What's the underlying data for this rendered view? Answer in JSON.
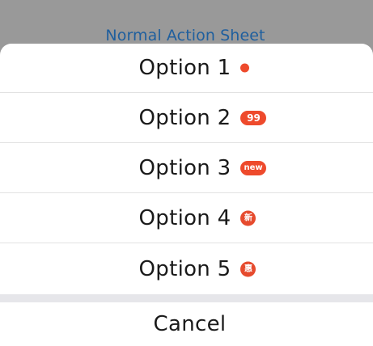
{
  "background_page": {
    "title": "Normal Action Sheet"
  },
  "action_sheet": {
    "options": [
      {
        "label": "Option 1",
        "badge_type": "dot",
        "badge_text": ""
      },
      {
        "label": "Option 2",
        "badge_type": "pill",
        "badge_text": "99"
      },
      {
        "label": "Option 3",
        "badge_type": "pill",
        "badge_text": "new"
      },
      {
        "label": "Option 4",
        "badge_type": "circle",
        "badge_text": "新"
      },
      {
        "label": "Option 5",
        "badge_type": "circle",
        "badge_text": "惠"
      }
    ],
    "cancel_label": "Cancel"
  },
  "colors": {
    "backdrop": "#999999",
    "badge": "#ee4a2c",
    "title_link": "#1f5f9e",
    "divider": "#e6e6ea"
  }
}
